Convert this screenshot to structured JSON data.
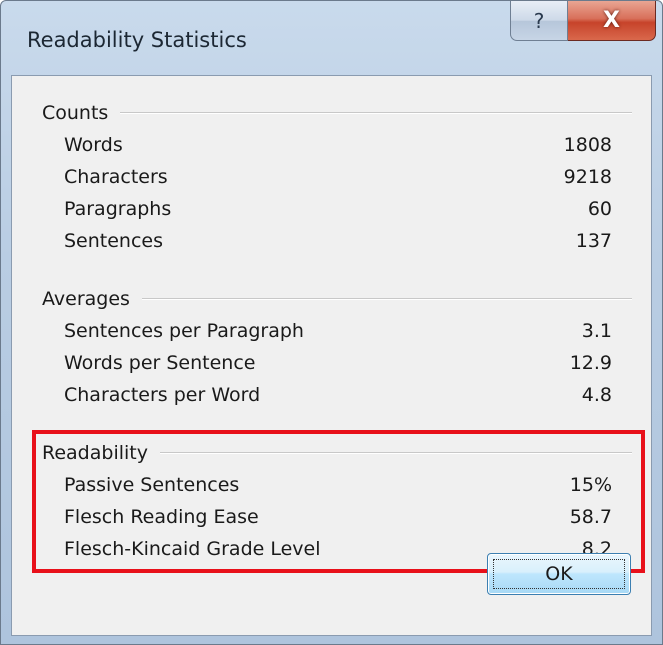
{
  "window": {
    "title": "Readability Statistics",
    "help_glyph": "?",
    "close_glyph": "X"
  },
  "counts": {
    "header": "Counts",
    "rows": [
      {
        "label": "Words",
        "value": "1808"
      },
      {
        "label": "Characters",
        "value": "9218"
      },
      {
        "label": "Paragraphs",
        "value": "60"
      },
      {
        "label": "Sentences",
        "value": "137"
      }
    ]
  },
  "averages": {
    "header": "Averages",
    "rows": [
      {
        "label": "Sentences per Paragraph",
        "value": "3.1"
      },
      {
        "label": "Words per Sentence",
        "value": "12.9"
      },
      {
        "label": "Characters per Word",
        "value": "4.8"
      }
    ]
  },
  "readability": {
    "header": "Readability",
    "highlight_color": "#e8101a",
    "rows": [
      {
        "label": "Passive Sentences",
        "value": "15%"
      },
      {
        "label": "Flesch Reading Ease",
        "value": "58.7"
      },
      {
        "label": "Flesch-Kincaid Grade Level",
        "value": "8.2"
      }
    ]
  },
  "buttons": {
    "ok_label": "OK"
  },
  "icons": [
    "help-icon",
    "close-icon"
  ]
}
